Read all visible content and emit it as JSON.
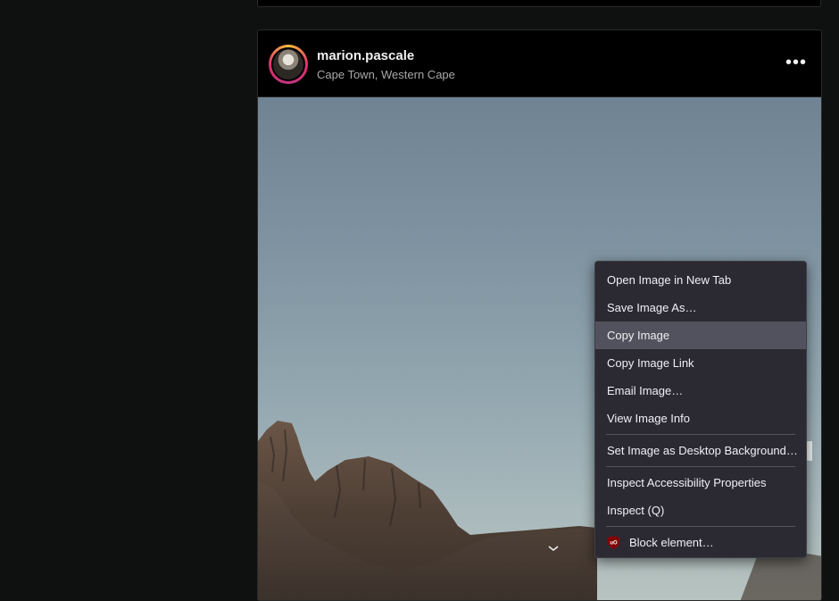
{
  "post": {
    "username": "marion.pascale",
    "location": "Cape Town, Western Cape",
    "more_label": "•••"
  },
  "context_menu": {
    "items": [
      "Open Image in New Tab",
      "Save Image As…",
      "Copy Image",
      "Copy Image Link",
      "Email Image…",
      "View Image Info",
      "Set Image as Desktop Background…",
      "Inspect Accessibility Properties",
      "Inspect (Q)",
      "Block element…"
    ],
    "highlighted": "Copy Image",
    "block_icon": "ublock-origin-icon"
  },
  "colors": {
    "page_bg": "#0f1111",
    "menu_bg": "#2b2a33",
    "menu_highlight": "#52525e",
    "ublock_red": "#800000"
  }
}
